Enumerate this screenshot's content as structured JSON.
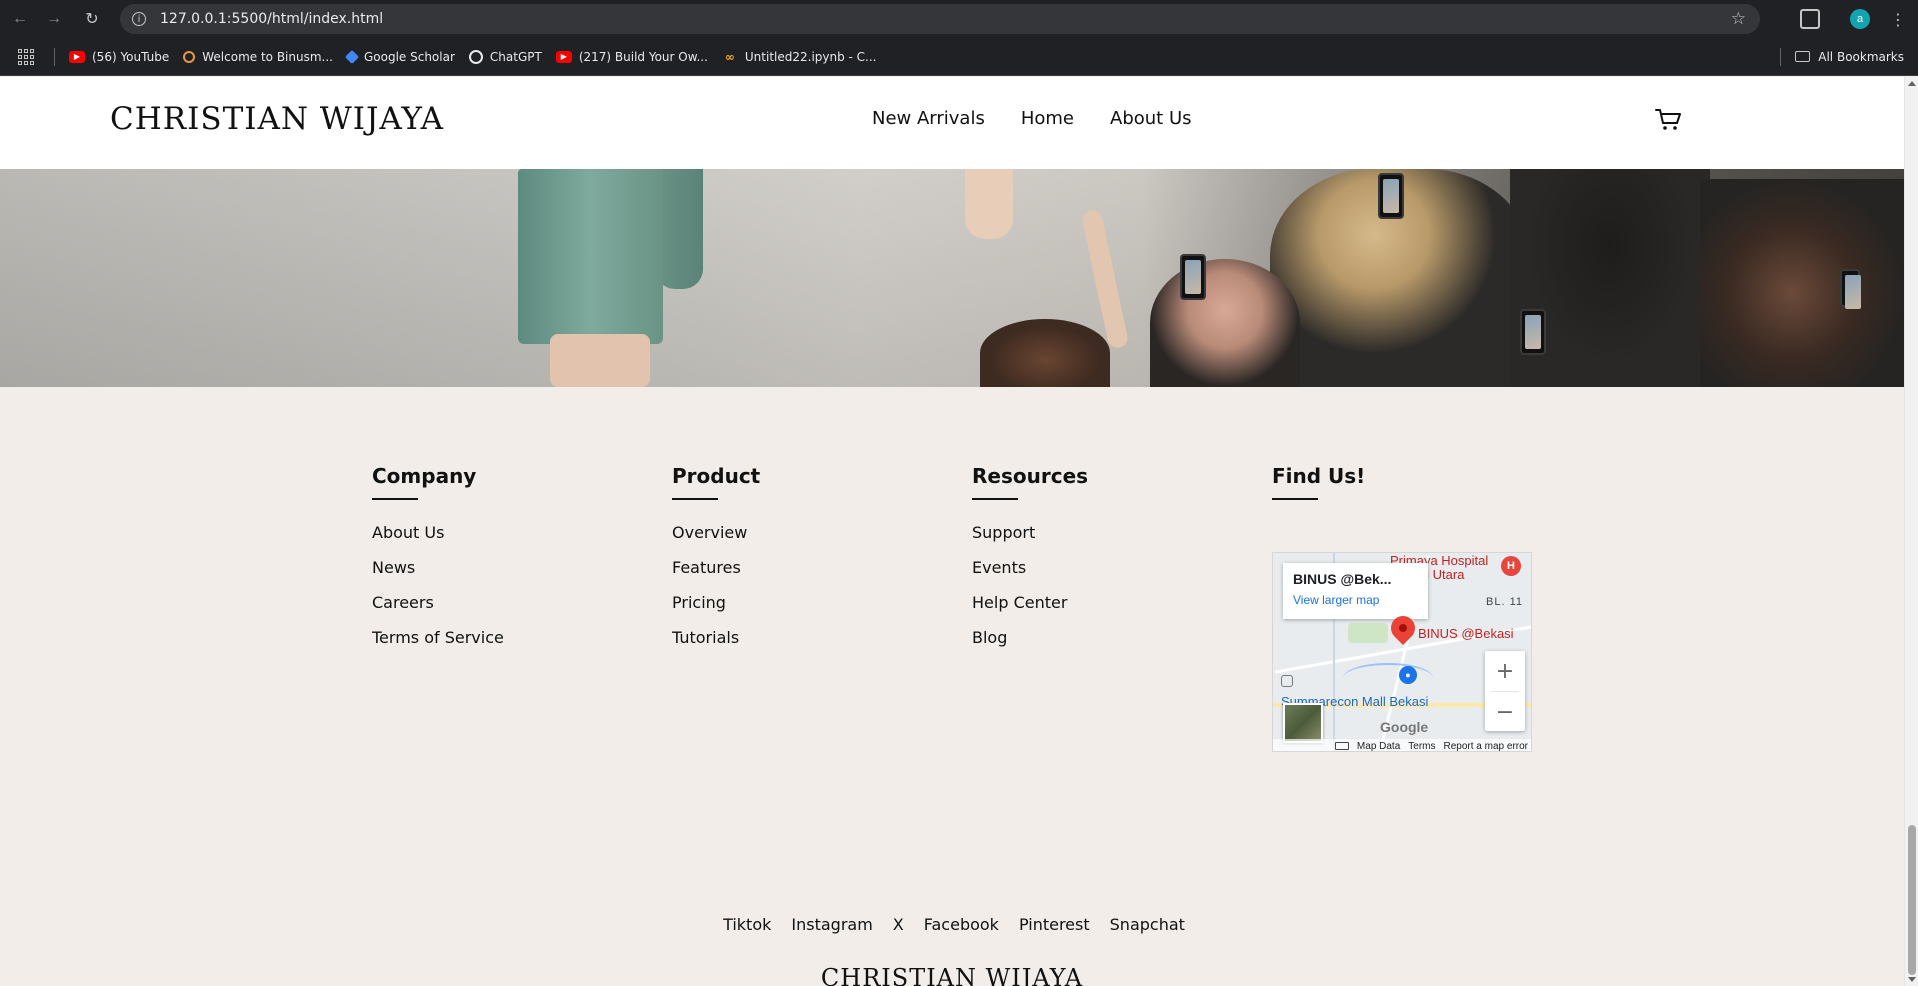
{
  "browser": {
    "url": "127.0.0.1:5500/html/index.html",
    "profile_initial": "a",
    "bookmarks": [
      {
        "label": "(56) YouTube",
        "icon": "youtube-icon"
      },
      {
        "label": "Welcome to Binusm...",
        "icon": "binus-icon"
      },
      {
        "label": "Google Scholar",
        "icon": "google-scholar-icon"
      },
      {
        "label": "ChatGPT",
        "icon": "chatgpt-icon"
      },
      {
        "label": "(217) Build Your Ow...",
        "icon": "youtube-icon"
      },
      {
        "label": "Untitled22.ipynb - C...",
        "icon": "colab-icon"
      }
    ],
    "all_bookmarks": "All Bookmarks"
  },
  "header": {
    "logo": "CHRISTIAN WIJAYA",
    "nav": [
      "New Arrivals",
      "Home",
      "About Us"
    ],
    "cart_icon": "cart-icon"
  },
  "footer": {
    "columns": [
      {
        "title": "Company",
        "links": [
          "About Us",
          "News",
          "Careers",
          "Terms of Service"
        ]
      },
      {
        "title": "Product",
        "links": [
          "Overview",
          "Features",
          "Pricing",
          "Tutorials"
        ]
      },
      {
        "title": "Resources",
        "links": [
          "Support",
          "Events",
          "Help Center",
          "Blog"
        ]
      },
      {
        "title": "Find Us!",
        "links": []
      }
    ],
    "map": {
      "place_name": "BINUS @Bek...",
      "larger_map": "View larger map",
      "hospital": "Primaya Hospital\nBekasi Utara",
      "hospital_icon": "H",
      "road_label": "BL. 11",
      "pin_label": "BINUS @Bekasi",
      "mall": "Summarecon Mall Bekasi",
      "zoom_in": "+",
      "zoom_out": "−",
      "brand": "Google",
      "map_data": "Map Data",
      "terms": "Terms",
      "report": "Report a map error"
    },
    "social": [
      "Tiktok",
      "Instagram",
      "X",
      "Facebook",
      "Pinterest",
      "Snapchat"
    ],
    "logo": "CHRISTIAN WIJAYA"
  }
}
